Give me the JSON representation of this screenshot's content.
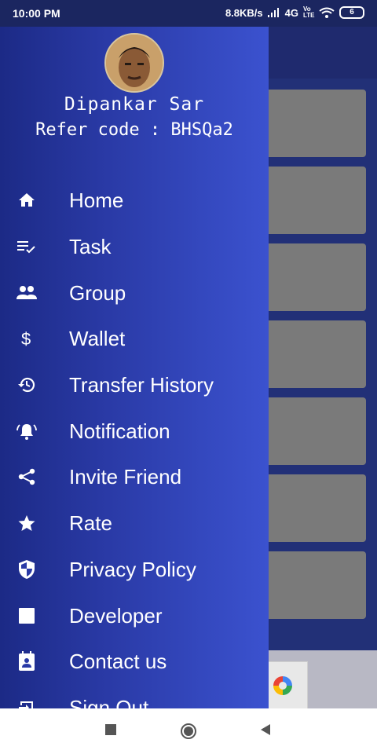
{
  "status_bar": {
    "time": "10:00 PM",
    "network_speed": "8.8KB/s",
    "network_type": "4G",
    "volte": "Vo LTE",
    "battery": "6"
  },
  "drawer": {
    "profile_name": "Dipankar Sar",
    "refer_code": "Refer code : BHSQa2",
    "menu": [
      {
        "label": "Home",
        "icon": "home-icon"
      },
      {
        "label": "Task",
        "icon": "task-list-icon"
      },
      {
        "label": "Group",
        "icon": "group-icon"
      },
      {
        "label": "Wallet",
        "icon": "dollar-icon"
      },
      {
        "label": "Transfer History",
        "icon": "history-icon"
      },
      {
        "label": "Notification",
        "icon": "bell-icon"
      },
      {
        "label": "Invite Friend",
        "icon": "share-icon"
      },
      {
        "label": "Rate",
        "icon": "star-icon"
      },
      {
        "label": "Privacy Policy",
        "icon": "shield-icon"
      },
      {
        "label": "Developer",
        "icon": "square-icon"
      },
      {
        "label": "Contact us",
        "icon": "contact-card-icon"
      },
      {
        "label": "Sign Out",
        "icon": "sign-out-icon"
      }
    ]
  },
  "colors": {
    "drawer_start": "#1c2a86",
    "drawer_end": "#3b52cf",
    "background": "#223077"
  }
}
